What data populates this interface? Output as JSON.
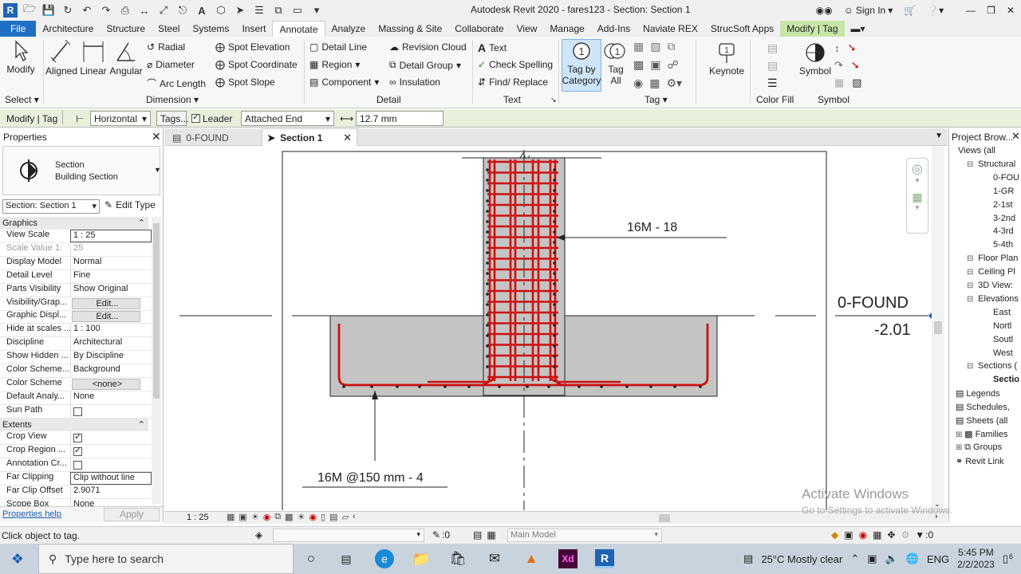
{
  "window": {
    "title": "Autodesk Revit 2020 - fares123 - Section: Section 1",
    "sign_in": "Sign In"
  },
  "menu_tabs": [
    "File",
    "Architecture",
    "Structure",
    "Steel",
    "Systems",
    "Insert",
    "Annotate",
    "Analyze",
    "Massing & Site",
    "Collaborate",
    "View",
    "Manage",
    "Add-Ins",
    "Naviate REX",
    "StrucSoft Apps",
    "Modify | Tag"
  ],
  "ribbon": {
    "select": {
      "modify": "Modify",
      "panel": "Select"
    },
    "dimension": {
      "aligned": "Aligned",
      "linear": "Linear",
      "angular": "Angular",
      "radial": "Radial",
      "diameter": "Diameter",
      "arc_length": "Arc  Length",
      "spot_elevation": "Spot  Elevation",
      "spot_coordinate": "Spot  Coordinate",
      "spot_slope": "Spot  Slope",
      "panel": "Dimension"
    },
    "detail": {
      "detail_line": "Detail Line",
      "region": "Region",
      "component": "Component",
      "revision_cloud": "Revision  Cloud",
      "detail_group": "Detail  Group",
      "insulation": "Insulation",
      "panel": "Detail"
    },
    "text": {
      "text": "Text",
      "check_spelling": "Check  Spelling",
      "find_replace": "Find/  Replace",
      "panel": "Text"
    },
    "tag": {
      "tag_by_category_1": "Tag by",
      "tag_by_category_2": "Category",
      "tag_all_1": "Tag",
      "tag_all_2": "All",
      "panel": "Tag"
    },
    "keynote": "Keynote",
    "color_fill": "Color Fill",
    "symbol": {
      "label": "Symbol",
      "panel": "Symbol"
    }
  },
  "options_bar": {
    "context": "Modify | Tag",
    "orientation": "Horizontal",
    "tags_button": "Tags...",
    "leader_label": "Leader",
    "leader_checked": true,
    "attachment": "Attached End",
    "length": "12.7 mm"
  },
  "properties": {
    "title": "Properties",
    "type_family": "Section",
    "type_name": "Building Section",
    "selector": "Section: Section 1",
    "edit_type": "Edit Type",
    "group_graphics": "Graphics",
    "group_extents": "Extents",
    "rows": [
      {
        "k": "View Scale",
        "v": "1 : 25",
        "kind": "input"
      },
      {
        "k": "Scale Value    1:",
        "v": "25",
        "kind": "dim"
      },
      {
        "k": "Display Model",
        "v": "Normal",
        "kind": "text"
      },
      {
        "k": "Detail Level",
        "v": "Fine",
        "kind": "text"
      },
      {
        "k": "Parts Visibility",
        "v": "Show Original",
        "kind": "text"
      },
      {
        "k": "Visibility/Grap...",
        "v": "Edit...",
        "kind": "button"
      },
      {
        "k": "Graphic Displ...",
        "v": "Edit...",
        "kind": "button"
      },
      {
        "k": "Hide at scales ...",
        "v": "1 : 100",
        "kind": "text"
      },
      {
        "k": "Discipline",
        "v": "Architectural",
        "kind": "text"
      },
      {
        "k": "Show Hidden ...",
        "v": "By Discipline",
        "kind": "text"
      },
      {
        "k": "Color Scheme...",
        "v": "Background",
        "kind": "text"
      },
      {
        "k": "Color Scheme",
        "v": "<none>",
        "kind": "button"
      },
      {
        "k": "Default Analy...",
        "v": "None",
        "kind": "text"
      },
      {
        "k": "Sun Path",
        "v": "",
        "kind": "check_off"
      }
    ],
    "extents_rows": [
      {
        "k": "Crop View",
        "v": "",
        "kind": "check_on"
      },
      {
        "k": "Crop Region ...",
        "v": "",
        "kind": "check_on"
      },
      {
        "k": "Annotation Cr...",
        "v": "",
        "kind": "check_off"
      },
      {
        "k": "Far Clipping",
        "v": "Clip without line",
        "kind": "input"
      },
      {
        "k": "Far Clip Offset",
        "v": "2.9071",
        "kind": "text"
      },
      {
        "k": "Scope Box",
        "v": "None",
        "kind": "text"
      }
    ],
    "help": "Properties help",
    "apply": "Apply"
  },
  "view_tabs": [
    {
      "label": "0-FOUND",
      "active": false
    },
    {
      "label": "Section 1",
      "active": true
    }
  ],
  "drawing": {
    "tag_upper": "16M - 18",
    "tag_lower": "16M  @150 mm - 4",
    "level_name": "0-FOUND",
    "level_value": "-2.01",
    "colors": {
      "rebar": "#cc1010",
      "concrete": "#c4c4c4"
    }
  },
  "project_browser": {
    "title": "Project Brow...",
    "items": [
      {
        "label": "Views (all",
        "indent": 0
      },
      {
        "label": "Structural",
        "indent": 1
      },
      {
        "label": "0-FOU",
        "indent": 3
      },
      {
        "label": "1-GR",
        "indent": 3
      },
      {
        "label": "2-1st",
        "indent": 3
      },
      {
        "label": "3-2nd",
        "indent": 3
      },
      {
        "label": "4-3rd",
        "indent": 3
      },
      {
        "label": "5-4th",
        "indent": 3
      },
      {
        "label": "Floor Plan",
        "indent": 1
      },
      {
        "label": "Ceiling Pl",
        "indent": 1
      },
      {
        "label": "3D View:",
        "indent": 1
      },
      {
        "label": "Elevations",
        "indent": 1
      },
      {
        "label": "East",
        "indent": 3
      },
      {
        "label": "Nortl",
        "indent": 3
      },
      {
        "label": "Soutl",
        "indent": 3
      },
      {
        "label": "West",
        "indent": 3
      },
      {
        "label": "Sections (",
        "indent": 1
      },
      {
        "label": "Sectio",
        "indent": 3
      },
      {
        "label": "Legends",
        "indent": 0
      },
      {
        "label": "Schedules,",
        "indent": 0
      },
      {
        "label": "Sheets (all",
        "indent": 0
      },
      {
        "label": "Families",
        "indent": 0
      },
      {
        "label": "Groups",
        "indent": 0
      },
      {
        "label": "Revit Link",
        "indent": 0
      }
    ]
  },
  "view_control": {
    "scale": "1 : 25"
  },
  "status": {
    "message": "Click object to tag.",
    "selection_count": ":0",
    "model": "Main Model",
    "filter_count": ":0"
  },
  "watermark": {
    "line1": "Activate Windows",
    "line2": "Go to Settings to activate Windows."
  },
  "taskbar": {
    "search_placeholder": "Type here to search",
    "weather": "25°C  Mostly clear",
    "lang": "ENG",
    "time": "5:45 PM",
    "date": "2/2/2023",
    "notifications": "6"
  }
}
